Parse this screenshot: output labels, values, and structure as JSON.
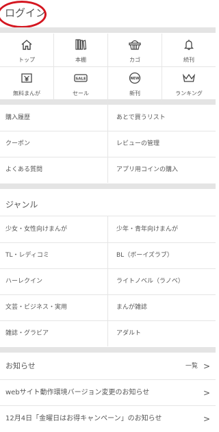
{
  "header": {
    "login_label": "ログイン",
    "highlight_color": "#d41620"
  },
  "icons": [
    {
      "label": "トップ",
      "icon": "home-icon"
    },
    {
      "label": "本棚",
      "icon": "bookshelf-icon"
    },
    {
      "label": "カゴ",
      "icon": "basket-icon"
    },
    {
      "label": "続刊",
      "icon": "bell-icon"
    },
    {
      "label": "無料まんが",
      "icon": "free-yen-icon"
    },
    {
      "label": "セール",
      "icon": "sale-tag-icon"
    },
    {
      "label": "新刊",
      "icon": "new-badge-icon"
    },
    {
      "label": "ランキング",
      "icon": "crown-icon"
    }
  ],
  "account_menu": [
    "購入履歴",
    "あとで買うリスト",
    "クーポン",
    "レビューの管理",
    "よくある質問",
    "アプリ用コインの購入"
  ],
  "genre": {
    "title": "ジャンル",
    "items": [
      "少女・女性向けまんが",
      "少年・青年向けまんが",
      "TL・レディコミ",
      "BL（ボーイズラブ）",
      "ハーレクイン",
      "ライトノベル（ラノベ）",
      "文芸・ビジネス・実用",
      "まんが雑誌",
      "雑誌・グラビア",
      "アダルト"
    ]
  },
  "news": {
    "title": "お知らせ",
    "all_label": "一覧",
    "items": [
      "webサイト動作環境バージョン変更のお知らせ",
      "12月4日「金曜日はお得キャンペーン」のお知らせ"
    ]
  },
  "chevron": ">"
}
